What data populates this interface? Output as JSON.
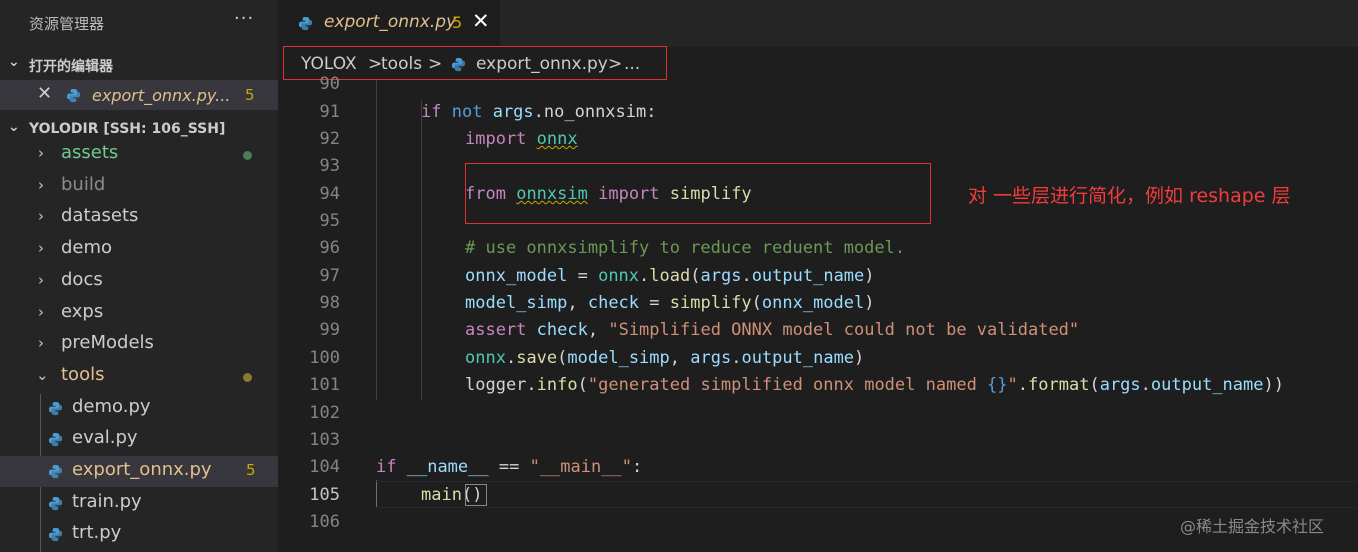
{
  "sidebar": {
    "title": "资源管理器",
    "more": "···",
    "open_editors": {
      "header": "打开的编辑器",
      "items": [
        {
          "name": "export_onnx.py...",
          "count": "5"
        }
      ]
    },
    "workspace": {
      "header": "YOLODIR [SSH: 106_SSH]",
      "items": [
        {
          "name": "assets",
          "type": "folder",
          "color": "#73c991"
        },
        {
          "name": "build",
          "type": "folder",
          "color": "#8c8c8c"
        },
        {
          "name": "datasets",
          "type": "folder"
        },
        {
          "name": "demo",
          "type": "folder"
        },
        {
          "name": "docs",
          "type": "folder"
        },
        {
          "name": "exps",
          "type": "folder"
        },
        {
          "name": "preModels",
          "type": "folder"
        },
        {
          "name": "tools",
          "type": "folder-open",
          "color": "#e2c08d"
        },
        {
          "name": "demo.py",
          "type": "file"
        },
        {
          "name": "eval.py",
          "type": "file"
        },
        {
          "name": "export_onnx.py",
          "type": "file",
          "count": "5",
          "color": "#e2c08d"
        },
        {
          "name": "train.py",
          "type": "file"
        },
        {
          "name": "trt.py",
          "type": "file"
        }
      ]
    }
  },
  "tab": {
    "name": "export_onnx.py",
    "count": "5"
  },
  "breadcrumb": {
    "parts": [
      "YOLOX",
      ">",
      "tools",
      ">",
      "export_onnx.py",
      ">",
      "..."
    ]
  },
  "code": {
    "line_numbers": [
      "90",
      "91",
      "92",
      "93",
      "94",
      "95",
      "96",
      "97",
      "98",
      "99",
      "100",
      "101",
      "102",
      "103",
      "104",
      "105",
      "106"
    ],
    "lines": {
      "l91_if": "if",
      "l91_not": "not",
      "l91_args": "args",
      "l91_rest": ".no_onnxsim:",
      "l92_import": "import",
      "l92_onnx": "onnx",
      "l94_from": "from",
      "l94_mod": "onnxsim",
      "l94_import": "import",
      "l94_fn": "simplify",
      "l96": "# use onnxsimplify to reduce reduent model.",
      "l97_a": "onnx_model",
      "l97_b": " = ",
      "l97_c": "onnx",
      "l97_d": ".",
      "l97_e": "load",
      "l97_f": "(",
      "l97_g": "args",
      "l97_h": ".",
      "l97_i": "output_name",
      "l97_j": ")",
      "l98_a": "model_simp",
      "l98_b": ", ",
      "l98_c": "check",
      "l98_d": " = ",
      "l98_e": "simplify",
      "l98_f": "(",
      "l98_g": "onnx_model",
      "l98_h": ")",
      "l99_a": "assert",
      "l99_b": " ",
      "l99_c": "check",
      "l99_d": ", ",
      "l99_e": "\"Simplified ONNX model could not be validated\"",
      "l100_a": "onnx",
      "l100_b": ".",
      "l100_c": "save",
      "l100_d": "(",
      "l100_e": "model_simp",
      "l100_f": ", ",
      "l100_g": "args",
      "l100_h": ".",
      "l100_i": "output_name",
      "l100_j": ")",
      "l101_a": "logger",
      "l101_b": ".",
      "l101_c": "info",
      "l101_d": "(",
      "l101_e": "\"generated simplified onnx model named ",
      "l101_f": "{}",
      "l101_g": "\"",
      "l101_h": ".",
      "l101_i": "format",
      "l101_j": "(",
      "l101_k": "args",
      "l101_l": ".",
      "l101_m": "output_name",
      "l101_n": "))",
      "l104_a": "if",
      "l104_b": " ",
      "l104_c": "__name__",
      "l104_d": " == ",
      "l104_e": "\"__main__\"",
      "l104_f": ":",
      "l105_a": "main",
      "l105_b": "()"
    }
  },
  "annotation": "对 一些层进行简化，例如 reshape 层",
  "watermark": "@稀土掘金技术社区"
}
